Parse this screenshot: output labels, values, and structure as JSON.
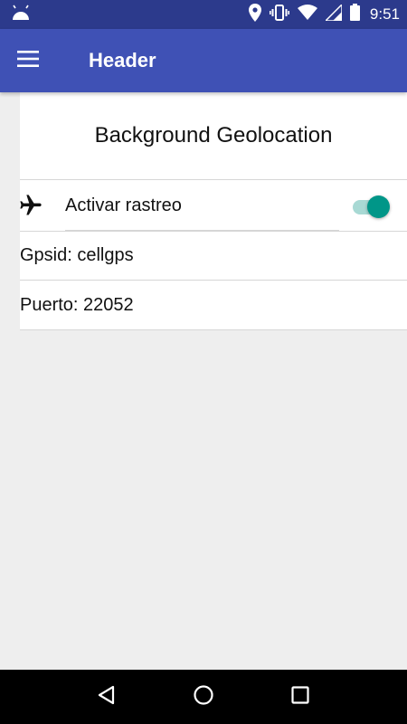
{
  "status_bar": {
    "time": "9:51",
    "icons": [
      "android-icon",
      "location-icon",
      "vibrate-icon",
      "wifi-icon",
      "signal-icon",
      "battery-icon"
    ]
  },
  "app_bar": {
    "title": "Header",
    "menu_icon": "menu-icon"
  },
  "card": {
    "title": "Background Geolocation"
  },
  "tracking_toggle": {
    "icon": "airplane-icon",
    "label": "Activar rastreo",
    "enabled": true
  },
  "info": {
    "gpsid": "Gpsid: cellgps",
    "puerto": "Puerto: 22052"
  },
  "nav_bar": {
    "buttons": [
      "back-icon",
      "home-icon",
      "recents-icon"
    ]
  },
  "colors": {
    "status_bar": "#2c3a8c",
    "app_bar": "#3f51b5",
    "accent": "#009688",
    "background": "#eeeeee"
  }
}
